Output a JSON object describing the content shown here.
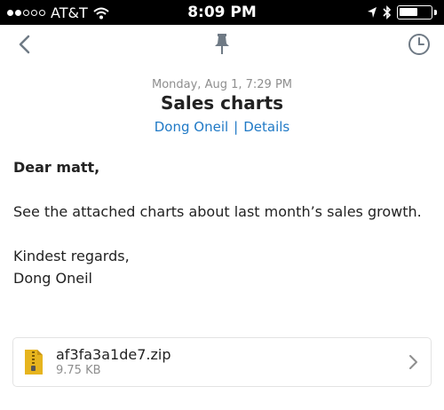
{
  "status_bar": {
    "carrier": "AT&T",
    "time": "8:09 PM",
    "signal_bars_filled": 2,
    "signal_bars_total": 5,
    "battery_level": 0.6,
    "icons": [
      "wifi-icon",
      "location-arrow-icon",
      "bluetooth-icon",
      "battery-icon"
    ]
  },
  "nav": {
    "icons": [
      "back-chevron-icon",
      "pin-icon",
      "clock-icon"
    ],
    "accent_color": "#6f7a85"
  },
  "message": {
    "date": "Monday, Aug 1, 7:29 PM",
    "subject": "Sales charts",
    "sender": "Dong Oneil",
    "separator": "|",
    "details_label": "Details",
    "link_color": "#1f79c6",
    "greeting": "Dear matt,",
    "paragraph": "See the attached charts about last month’s sales growth.",
    "closing": "Kindest regards,",
    "signature": "Dong Oneil"
  },
  "attachment": {
    "file_name": "af3fa3a1de7.zip",
    "file_size": "9.75 KB",
    "icon": "zip-file-icon",
    "icon_color": "#e6b41e"
  }
}
